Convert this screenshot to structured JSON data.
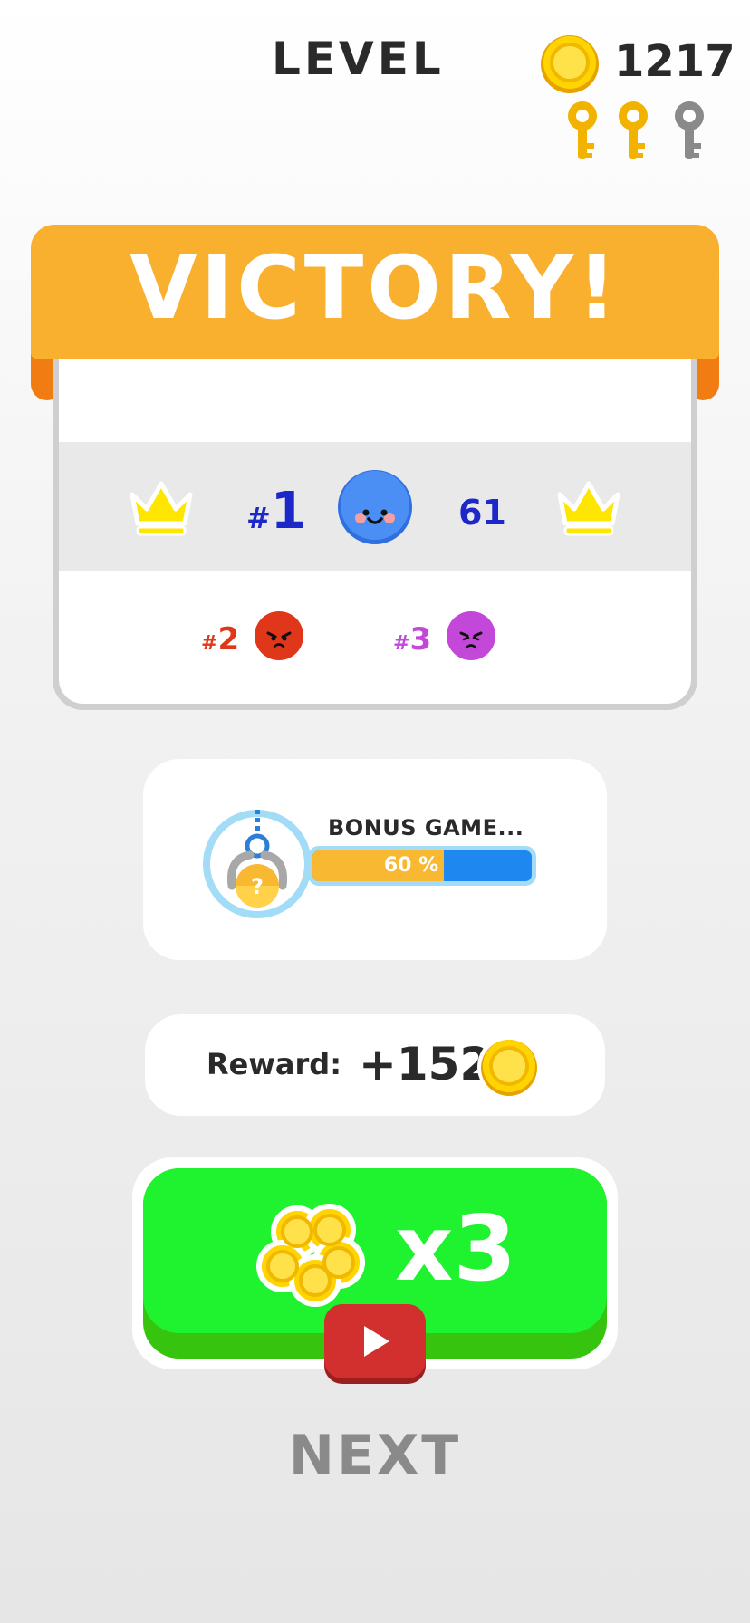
{
  "header": {
    "level_label": "LEVEL",
    "coin_count": "1217",
    "keys": [
      "collected",
      "collected",
      "empty"
    ],
    "coin_icon": "coin-icon",
    "key_icon": "key-icon"
  },
  "banner": {
    "title": "VICTORY!",
    "color": "#f9b02f"
  },
  "leaderboard": {
    "first": {
      "hash": "#",
      "rank": "1",
      "score": "61",
      "avatar": "blue-smile-face",
      "color": "#1c28c8",
      "crown_icon": "crown-icon"
    },
    "others": [
      {
        "hash": "#",
        "rank": "2",
        "avatar": "red-angry-face",
        "color": "#e0361a"
      },
      {
        "hash": "#",
        "rank": "3",
        "avatar": "purple-angry-face",
        "color": "#c347d9"
      }
    ]
  },
  "bonus": {
    "label": "BONUS GAME...",
    "progress_text": "60 %",
    "progress": 0.6,
    "icon": "claw-machine-icon",
    "question_mark": "?"
  },
  "reward": {
    "label": "Reward:",
    "value": "+152",
    "icon": "coin-icon"
  },
  "multiplier_button": {
    "label": "x3",
    "icon": "coin-pile-icon",
    "badge_icon": "play-video-icon",
    "color": "#1ff22e"
  },
  "next_button": {
    "label": "NEXT"
  }
}
